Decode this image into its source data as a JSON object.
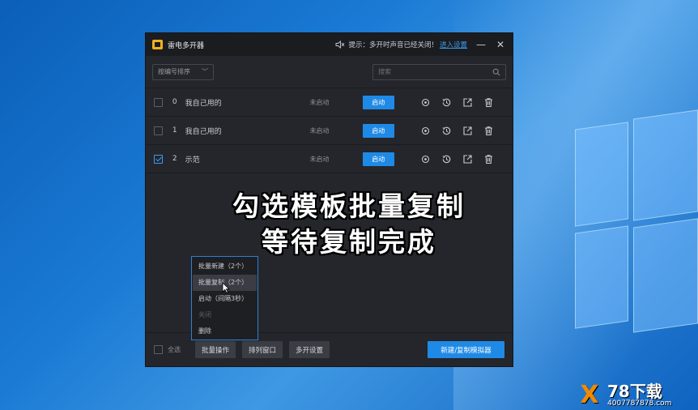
{
  "window": {
    "title": "雷电多开器",
    "hint": "提示：多开时声音已经关闭！",
    "hint_link": "进入设置"
  },
  "toolbar": {
    "sort_label": "按编号排序",
    "search_placeholder": "搜索"
  },
  "instances": [
    {
      "index": "0",
      "name": "我自己用的",
      "status": "未启动",
      "start_label": "启动",
      "checked": false
    },
    {
      "index": "1",
      "name": "我自己用的",
      "status": "未启动",
      "start_label": "启动",
      "checked": false
    },
    {
      "index": "2",
      "name": "示范",
      "status": "未启动",
      "start_label": "启动",
      "checked": true
    }
  ],
  "caption": {
    "line1": "勾选模板批量复制",
    "line2": "等待复制完成"
  },
  "batch_menu": [
    {
      "label": "批量新建（2个）"
    },
    {
      "label": "批量复制（2个）"
    },
    {
      "label": "启动（间隔3秒）"
    },
    {
      "label": "关闭"
    },
    {
      "label": "删除"
    }
  ],
  "footer": {
    "select_all": "全选",
    "batch_ops": "批量操作",
    "arrange": "排列窗口",
    "multi_settings": "多开设置",
    "new_copy": "新建/复制模拟器"
  },
  "watermark": {
    "logo": "X",
    "title": "78下载",
    "sub": "4007787878.com"
  },
  "colors": {
    "accent": "#1f8ae6",
    "window_bg": "#24262b",
    "desktop": "#1a7ad4"
  }
}
